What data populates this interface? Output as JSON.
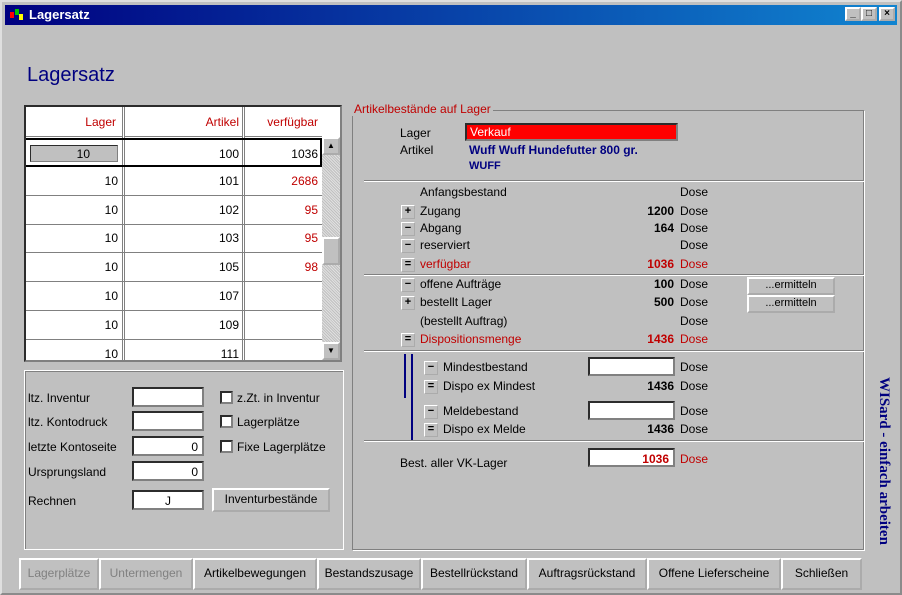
{
  "window": {
    "title": "Lagersatz"
  },
  "heading": "Lagersatz",
  "grid": {
    "headers": [
      "Lager",
      "Artikel",
      "verfügbar"
    ],
    "rows": [
      {
        "lager": "10",
        "artikel": "100",
        "verf": "1036",
        "color": "#000000"
      },
      {
        "lager": "10",
        "artikel": "101",
        "verf": "2686",
        "color": "#c00000"
      },
      {
        "lager": "10",
        "artikel": "102",
        "verf": "95",
        "color": "#c00000"
      },
      {
        "lager": "10",
        "artikel": "103",
        "verf": "95",
        "color": "#c00000"
      },
      {
        "lager": "10",
        "artikel": "105",
        "verf": "98",
        "color": "#c00000"
      },
      {
        "lager": "10",
        "artikel": "107",
        "verf": "",
        "color": "#000000"
      },
      {
        "lager": "10",
        "artikel": "109",
        "verf": "",
        "color": "#000000"
      },
      {
        "lager": "10",
        "artikel": "111",
        "verf": "",
        "color": "#000000"
      }
    ]
  },
  "left": {
    "ltz_inventur": {
      "label": "ltz. Inventur",
      "value": ""
    },
    "ltz_kontodruck": {
      "label": "ltz. Kontodruck",
      "value": ""
    },
    "letzte_kontoseite": {
      "label": "letzte Kontoseite",
      "value": "0"
    },
    "ursprungsland": {
      "label": "Ursprungsland",
      "value": "0"
    },
    "rechnen": {
      "label": "Rechnen",
      "value": "J"
    },
    "chk_inventur": "z.Zt. in Inventur",
    "chk_lagerplaetze": "Lagerplätze",
    "chk_fixe": "Fixe Lagerplätze",
    "inventur_button": "Inventurbestände"
  },
  "group": {
    "legend": "Artikelbestände auf Lager",
    "lager_label": "Lager",
    "lager_value": "Verkauf",
    "artikel_label": "Artikel",
    "artikel_line1": "Wuff Wuff Hundefutter 800 gr.",
    "artikel_line2": "WUFF",
    "rows": [
      {
        "sign": "",
        "label": "Anfangsbestand",
        "value": "",
        "unit": "Dose",
        "red": false
      },
      {
        "sign": "+",
        "label": "Zugang",
        "value": "1200",
        "unit": "Dose",
        "red": false
      },
      {
        "sign": "−",
        "label": "Abgang",
        "value": "164",
        "unit": "Dose",
        "red": false
      },
      {
        "sign": "−",
        "label": "reserviert",
        "value": "",
        "unit": "Dose",
        "red": false
      },
      {
        "sign": "=",
        "label": "verfügbar",
        "value": "1036",
        "unit": "Dose",
        "red": true
      },
      {
        "sign": "−",
        "label": "offene Aufträge",
        "value": "100",
        "unit": "Dose",
        "red": false
      },
      {
        "sign": "+",
        "label": "bestellt Lager",
        "value": "500",
        "unit": "Dose",
        "red": false
      },
      {
        "sign": "",
        "label": "(bestellt Auftrag)",
        "value": "",
        "unit": "Dose",
        "red": false
      },
      {
        "sign": "=",
        "label": "Dispositionsmenge",
        "value": "1436",
        "unit": "Dose",
        "red": true
      }
    ],
    "ermitteln1": "...ermitteln",
    "ermitteln2": "...ermitteln",
    "min": [
      {
        "sign": "−",
        "label": "Mindestbestand",
        "value": "",
        "unit": "Dose"
      },
      {
        "sign": "=",
        "label": "Dispo ex Mindest",
        "value": "1436",
        "unit": "Dose"
      },
      {
        "sign": "−",
        "label": "Meldebestand",
        "value": "",
        "unit": "Dose"
      },
      {
        "sign": "=",
        "label": "Dispo ex Melde",
        "value": "1436",
        "unit": "Dose"
      }
    ],
    "best_label": "Best. aller VK-Lager",
    "best_value": "1036",
    "best_unit": "Dose"
  },
  "side_text": "WISard - einfach arbeiten",
  "buttons": [
    "Lagerplätze",
    "Untermengen",
    "Artikelbewegungen",
    "Bestandszusage",
    "Bestellrückstand",
    "Auftragsrückstand",
    "Offene Lieferscheine",
    "Schließen"
  ]
}
